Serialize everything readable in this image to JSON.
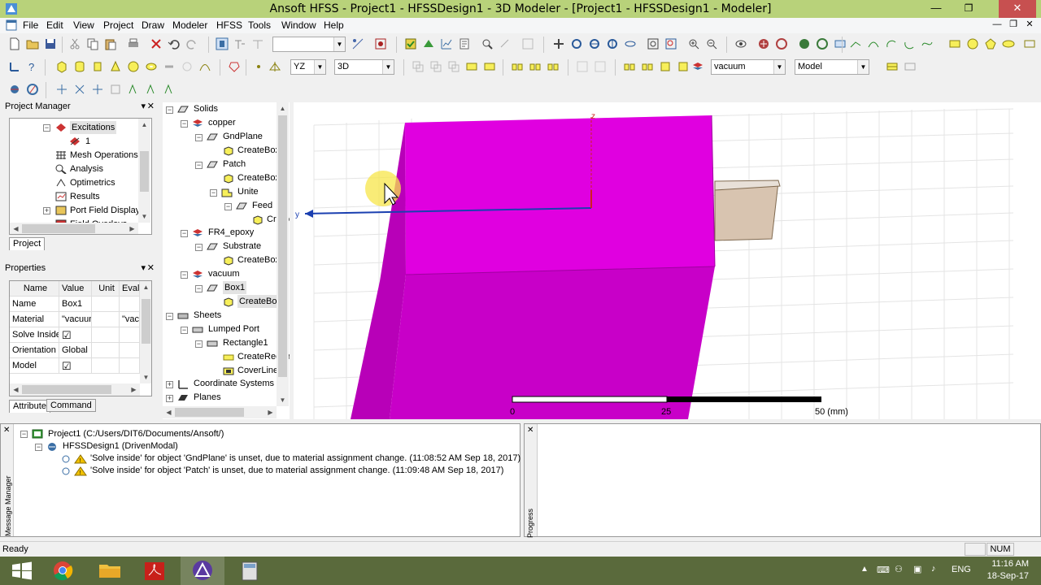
{
  "window": {
    "title": "Ansoft HFSS - Project1 - HFSSDesign1 - 3D Modeler - [Project1 - HFSSDesign1 - Modeler]",
    "minimize": "—",
    "restore": "❐",
    "close": "✕",
    "inner_minimize": "—",
    "inner_restore": "❐",
    "inner_close": "✕"
  },
  "menu": [
    "File",
    "Edit",
    "View",
    "Project",
    "Draw",
    "Modeler",
    "HFSS",
    "Tools",
    "Window",
    "Help"
  ],
  "toolbar": {
    "plane": "YZ",
    "mode": "3D",
    "material": "vacuum",
    "model": "Model"
  },
  "project_manager": {
    "title": "Project Manager",
    "items": [
      "Excitations",
      "1",
      "Mesh Operations",
      "Analysis",
      "Optimetrics",
      "Results",
      "Port Field Display",
      "Field Overlays"
    ],
    "tab": "Project"
  },
  "properties": {
    "title": "Properties",
    "headers": [
      "Name",
      "Value",
      "Unit",
      "Evaluated Value"
    ],
    "rows": [
      {
        "name": "Name",
        "value": "Box1",
        "unit": "",
        "eval": ""
      },
      {
        "name": "Material",
        "value": "\"vacuum\"",
        "unit": "",
        "eval": "\"vacuum\""
      },
      {
        "name": "Solve Inside",
        "value": "☑",
        "unit": "",
        "eval": ""
      },
      {
        "name": "Orientation",
        "value": "Global",
        "unit": "",
        "eval": ""
      },
      {
        "name": "Model",
        "value": "☑",
        "unit": "",
        "eval": ""
      }
    ],
    "tabs": [
      "Attribute",
      "Command"
    ]
  },
  "model_tree": {
    "items": [
      {
        "label": "Solids"
      },
      {
        "label": "copper"
      },
      {
        "label": "GndPlane"
      },
      {
        "label": "CreateBox"
      },
      {
        "label": "Patch"
      },
      {
        "label": "CreateBox"
      },
      {
        "label": "Unite"
      },
      {
        "label": "Feed"
      },
      {
        "label": "CreateBox"
      },
      {
        "label": "FR4_epoxy"
      },
      {
        "label": "Substrate"
      },
      {
        "label": "CreateBox"
      },
      {
        "label": "vacuum"
      },
      {
        "label": "Box1"
      },
      {
        "label": "CreateBox"
      },
      {
        "label": "Sheets"
      },
      {
        "label": "Lumped Port"
      },
      {
        "label": "Rectangle1"
      },
      {
        "label": "CreateRectangle"
      },
      {
        "label": "CoverLines"
      },
      {
        "label": "Coordinate Systems"
      },
      {
        "label": "Planes"
      }
    ]
  },
  "viewport": {
    "axis_z": "z",
    "axis_y": "y",
    "scale": {
      "ticks": [
        "0",
        "25",
        "50 (mm)"
      ]
    }
  },
  "messages": {
    "project": "Project1 (C:/Users/DIT6/Documents/Ansoft/)",
    "design": "HFSSDesign1 (DrivenModal)",
    "lines": [
      "'Solve inside' for object 'GndPlane' is unset, due to material assignment change. (11:08:52 AM  Sep 18, 2017)",
      "'Solve inside' for object 'Patch' is unset, due to material assignment change. (11:09:48 AM  Sep 18, 2017)"
    ],
    "side_label": "Message Manager",
    "progress_label": "Progress"
  },
  "status": {
    "text": "Ready",
    "num": "NUM"
  },
  "taskbar": {
    "lang": "ENG",
    "time": "11:16 AM",
    "date": "18-Sep-17"
  }
}
